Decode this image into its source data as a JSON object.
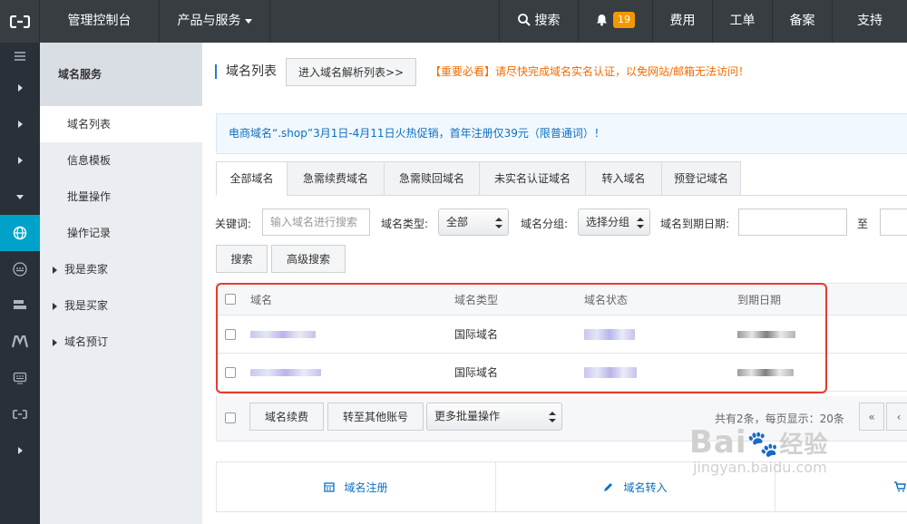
{
  "topbar": {
    "console": "管理控制台",
    "products": "产品与服务",
    "search": "搜索",
    "bell_count": "19",
    "fee": "费用",
    "ticket": "工单",
    "beian": "备案",
    "support": "支持"
  },
  "sidebar": {
    "title": "域名服务",
    "items": [
      {
        "label": "域名列表"
      },
      {
        "label": "信息模板"
      },
      {
        "label": "批量操作"
      },
      {
        "label": "操作记录"
      },
      {
        "label": "我是卖家"
      },
      {
        "label": "我是买家"
      },
      {
        "label": "域名预订"
      }
    ]
  },
  "main": {
    "title": "域名列表",
    "dns_button": "进入域名解析列表>>",
    "warning": "【重要必看】请尽快完成域名实名认证，以免网站/邮箱无法访问！",
    "promo": "电商域名“.shop”3月1日-4月11日火热促销，首年注册仅39元（限普通词）！",
    "tabs": [
      "全部域名",
      "急需续费域名",
      "急需赎回域名",
      "未实名认证域名",
      "转入域名",
      "预登记域名"
    ],
    "filters": {
      "keyword_label": "关键词:",
      "keyword_placeholder": "输入域名进行搜索",
      "type_label": "域名类型:",
      "type_value": "全部",
      "group_label": "域名分组:",
      "group_value": "选择分组",
      "expire_label": "域名到期日期:",
      "to_label": "至"
    },
    "search_button": "搜索",
    "advanced_button": "高级搜索",
    "table": {
      "headers": [
        "域名",
        "域名类型",
        "域名状态",
        "到期日期"
      ],
      "rows": [
        {
          "type": "国际域名"
        },
        {
          "type": "国际域名"
        }
      ]
    },
    "footer": {
      "renew_button": "域名续费",
      "transfer_button": "转至其他账号",
      "batch_select": "更多批量操作",
      "summary": "共有2条，每页显示：20条",
      "first_page": "«",
      "prev_page": "‹"
    },
    "actions": {
      "register": "域名注册",
      "transfer_in": "域名转入"
    }
  },
  "watermark": {
    "line1": "Bai",
    "line1b": "经验",
    "line2": "jingyan.baidu.com"
  },
  "colors": {
    "topbar": "#373d41",
    "rail": "#293038",
    "rail_active": "#00a2ca",
    "badge": "#f39800",
    "warning": "#f36c00",
    "link": "#0d6fc1",
    "highlight": "#e73a2f"
  }
}
